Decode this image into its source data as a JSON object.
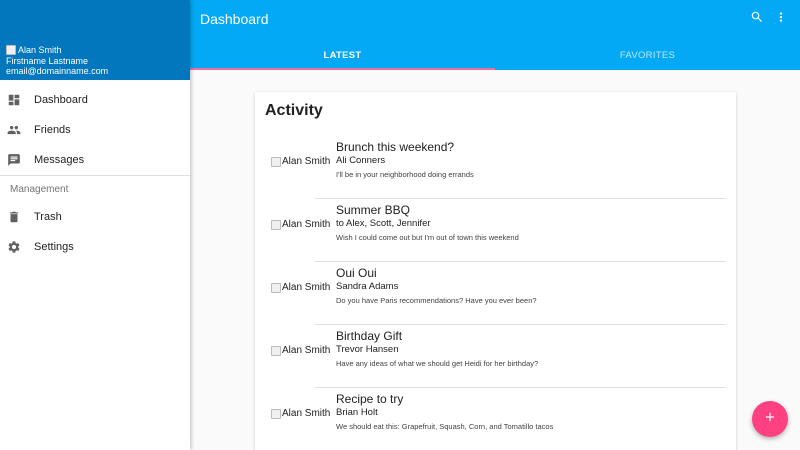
{
  "drawer": {
    "avatar_alt": "Alan Smith",
    "user_name": "Firstname Lastname",
    "user_email": "email@domainname.com",
    "items": [
      {
        "label": "Dashboard",
        "icon": "dashboard-icon"
      },
      {
        "label": "Friends",
        "icon": "people-icon"
      },
      {
        "label": "Messages",
        "icon": "message-icon"
      }
    ],
    "subheader": "Management",
    "management_items": [
      {
        "label": "Trash",
        "icon": "trash-icon"
      },
      {
        "label": "Settings",
        "icon": "gear-icon"
      }
    ],
    "header_color": "#0277bd"
  },
  "appbar": {
    "title": "Dashboard",
    "color": "#03a9f4",
    "tabs": [
      {
        "label": "LATEST",
        "active": true
      },
      {
        "label": "FAVORITES",
        "active": false
      }
    ],
    "indicator_color": "#ec6fa4"
  },
  "card": {
    "title": "Activity",
    "items": [
      {
        "avatar_alt": "Alan Smith",
        "title": "Brunch this weekend?",
        "subtitle": "Ali Conners",
        "body": "I'll be in your neighborhood doing errands"
      },
      {
        "avatar_alt": "Alan Smith",
        "title": "Summer BBQ",
        "subtitle": "to Alex, Scott, Jennifer",
        "body": "Wish I could come out but I'm out of town this weekend"
      },
      {
        "avatar_alt": "Alan Smith",
        "title": "Oui Oui",
        "subtitle": "Sandra Adams",
        "body": "Do you have Paris recommendations? Have you ever been?"
      },
      {
        "avatar_alt": "Alan Smith",
        "title": "Birthday Gift",
        "subtitle": "Trevor Hansen",
        "body": "Have any ideas of what we should get Heidi for her birthday?"
      },
      {
        "avatar_alt": "Alan Smith",
        "title": "Recipe to try",
        "subtitle": "Brian Holt",
        "body": "We should eat this: Grapefruit, Squash, Corn, and Tomatillo tacos"
      }
    ]
  },
  "fab": {
    "icon": "plus-icon",
    "color": "#ff4081"
  }
}
